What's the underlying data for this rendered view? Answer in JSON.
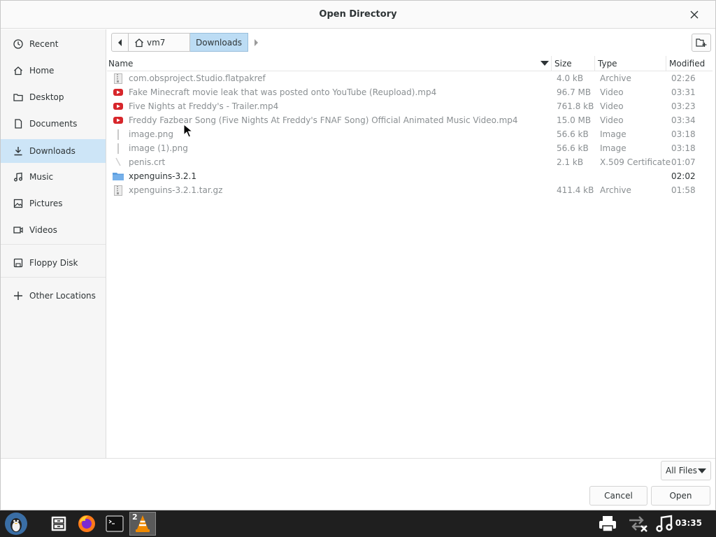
{
  "dialog": {
    "title": "Open Directory"
  },
  "sidebar": {
    "items": [
      {
        "label": "Recent",
        "icon": "clock-icon",
        "active": false
      },
      {
        "label": "Home",
        "icon": "home-icon",
        "active": false
      },
      {
        "label": "Desktop",
        "icon": "folder-icon",
        "active": false
      },
      {
        "label": "Documents",
        "icon": "document-icon",
        "active": false
      },
      {
        "label": "Downloads",
        "icon": "download-icon",
        "active": true
      },
      {
        "label": "Music",
        "icon": "music-icon",
        "active": false
      },
      {
        "label": "Pictures",
        "icon": "picture-icon",
        "active": false
      },
      {
        "label": "Videos",
        "icon": "video-icon",
        "active": false
      },
      {
        "label": "Floppy Disk",
        "icon": "floppy-icon",
        "active": false
      },
      {
        "label": "Other Locations",
        "icon": "plus-icon",
        "active": false
      }
    ]
  },
  "pathbar": {
    "home_label": "vm7",
    "current_label": "Downloads"
  },
  "columns": {
    "name": "Name",
    "size": "Size",
    "type": "Type",
    "modified": "Modified"
  },
  "files": [
    {
      "name": "com.obsproject.Studio.flatpakref",
      "size": "4.0 kB",
      "type": "Archive",
      "modified": "02:26",
      "icon": "archive-icon",
      "is_dir": false
    },
    {
      "name": "Fake Minecraft movie leak that was posted onto YouTube (Reupload).mp4",
      "size": "96.7 MB",
      "type": "Video",
      "modified": "03:31",
      "icon": "video-file-icon",
      "is_dir": false
    },
    {
      "name": "Five Nights at Freddy's - Trailer.mp4",
      "size": "761.8 kB",
      "type": "Video",
      "modified": "03:23",
      "icon": "video-file-icon",
      "is_dir": false
    },
    {
      "name": "Freddy Fazbear Song (Five Nights At Freddy's FNAF Song) Official Animated Music Video.mp4",
      "size": "15.0 MB",
      "type": "Video",
      "modified": "03:34",
      "icon": "video-file-icon",
      "is_dir": false
    },
    {
      "name": "image.png",
      "size": "56.6 kB",
      "type": "Image",
      "modified": "03:18",
      "icon": "image-file-icon",
      "is_dir": false
    },
    {
      "name": "image (1).png",
      "size": "56.6 kB",
      "type": "Image",
      "modified": "03:18",
      "icon": "image-file-icon",
      "is_dir": false
    },
    {
      "name": "penis.crt",
      "size": "2.1 kB",
      "type": "X.509 Certificate",
      "modified": "01:07",
      "icon": "certificate-icon",
      "is_dir": false
    },
    {
      "name": "xpenguins-3.2.1",
      "size": "",
      "type": "",
      "modified": "02:02",
      "icon": "folder-icon",
      "is_dir": true
    },
    {
      "name": "xpenguins-3.2.1.tar.gz",
      "size": "411.4 kB",
      "type": "Archive",
      "modified": "01:58",
      "icon": "archive-icon",
      "is_dir": false
    }
  ],
  "footer": {
    "filter_label": "All Files",
    "cancel_label": "Cancel",
    "open_label": "Open"
  },
  "taskbar": {
    "vlc_badge": "2",
    "clock": "03:35"
  },
  "colors": {
    "selection": "#cde5f7",
    "video_red": "#d7262b",
    "folder_blue": "#5d9fe0",
    "taskbar": "#1f1f1f"
  }
}
